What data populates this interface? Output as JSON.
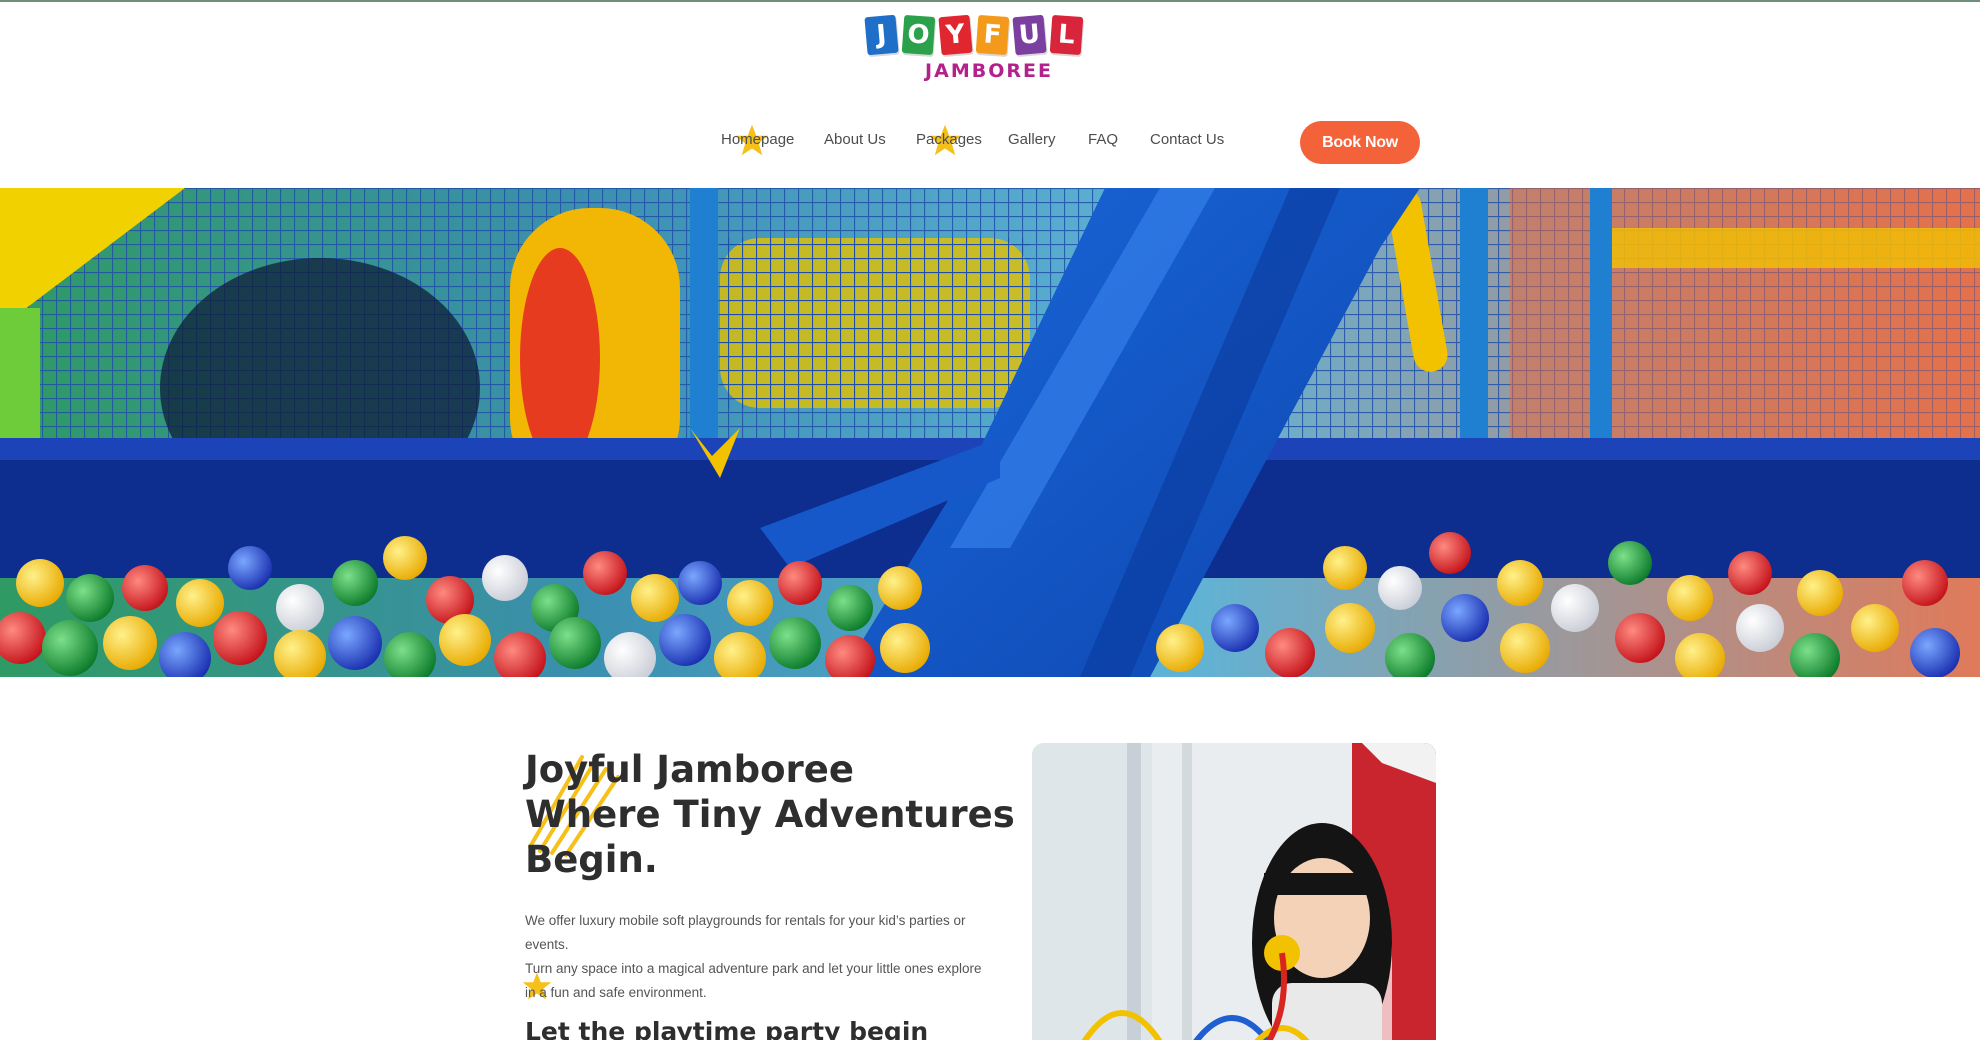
{
  "brand": {
    "logo_letters": [
      "J",
      "O",
      "Y",
      "F",
      "U",
      "L"
    ],
    "logo_colors": [
      "#1f6fc9",
      "#2aa14a",
      "#e0262f",
      "#f39a1b",
      "#7b3fa0",
      "#d8253b"
    ],
    "logo_subtitle": "JAMBOREE",
    "subtitle_color": "#b3218c"
  },
  "nav": {
    "items": [
      {
        "label": "Homepage",
        "starred": true
      },
      {
        "label": "About Us",
        "starred": false
      },
      {
        "label": "Packages",
        "starred": true
      },
      {
        "label": "Gallery",
        "starred": false
      },
      {
        "label": "FAQ",
        "starred": false
      },
      {
        "label": "Contact Us",
        "starred": false
      }
    ],
    "cta_label": "Book Now",
    "cta_color": "#f4623a",
    "accent_star_color": "#f5c01a"
  },
  "hero": {
    "image": "indoor-playground-ball-pit-with-blue-slide"
  },
  "intro": {
    "title_lines": [
      "Joyful Jamboree",
      "Where Tiny Adventures",
      "Begin."
    ],
    "description": [
      "We offer luxury mobile soft playgrounds for rentals for your kid’s parties or events.",
      "Turn any space into a magical adventure park and let your little ones explore in a fun and safe environment."
    ],
    "subheading": "Let the playtime party begin",
    "photo": "girl-playing-with-bead-maze-toy"
  }
}
